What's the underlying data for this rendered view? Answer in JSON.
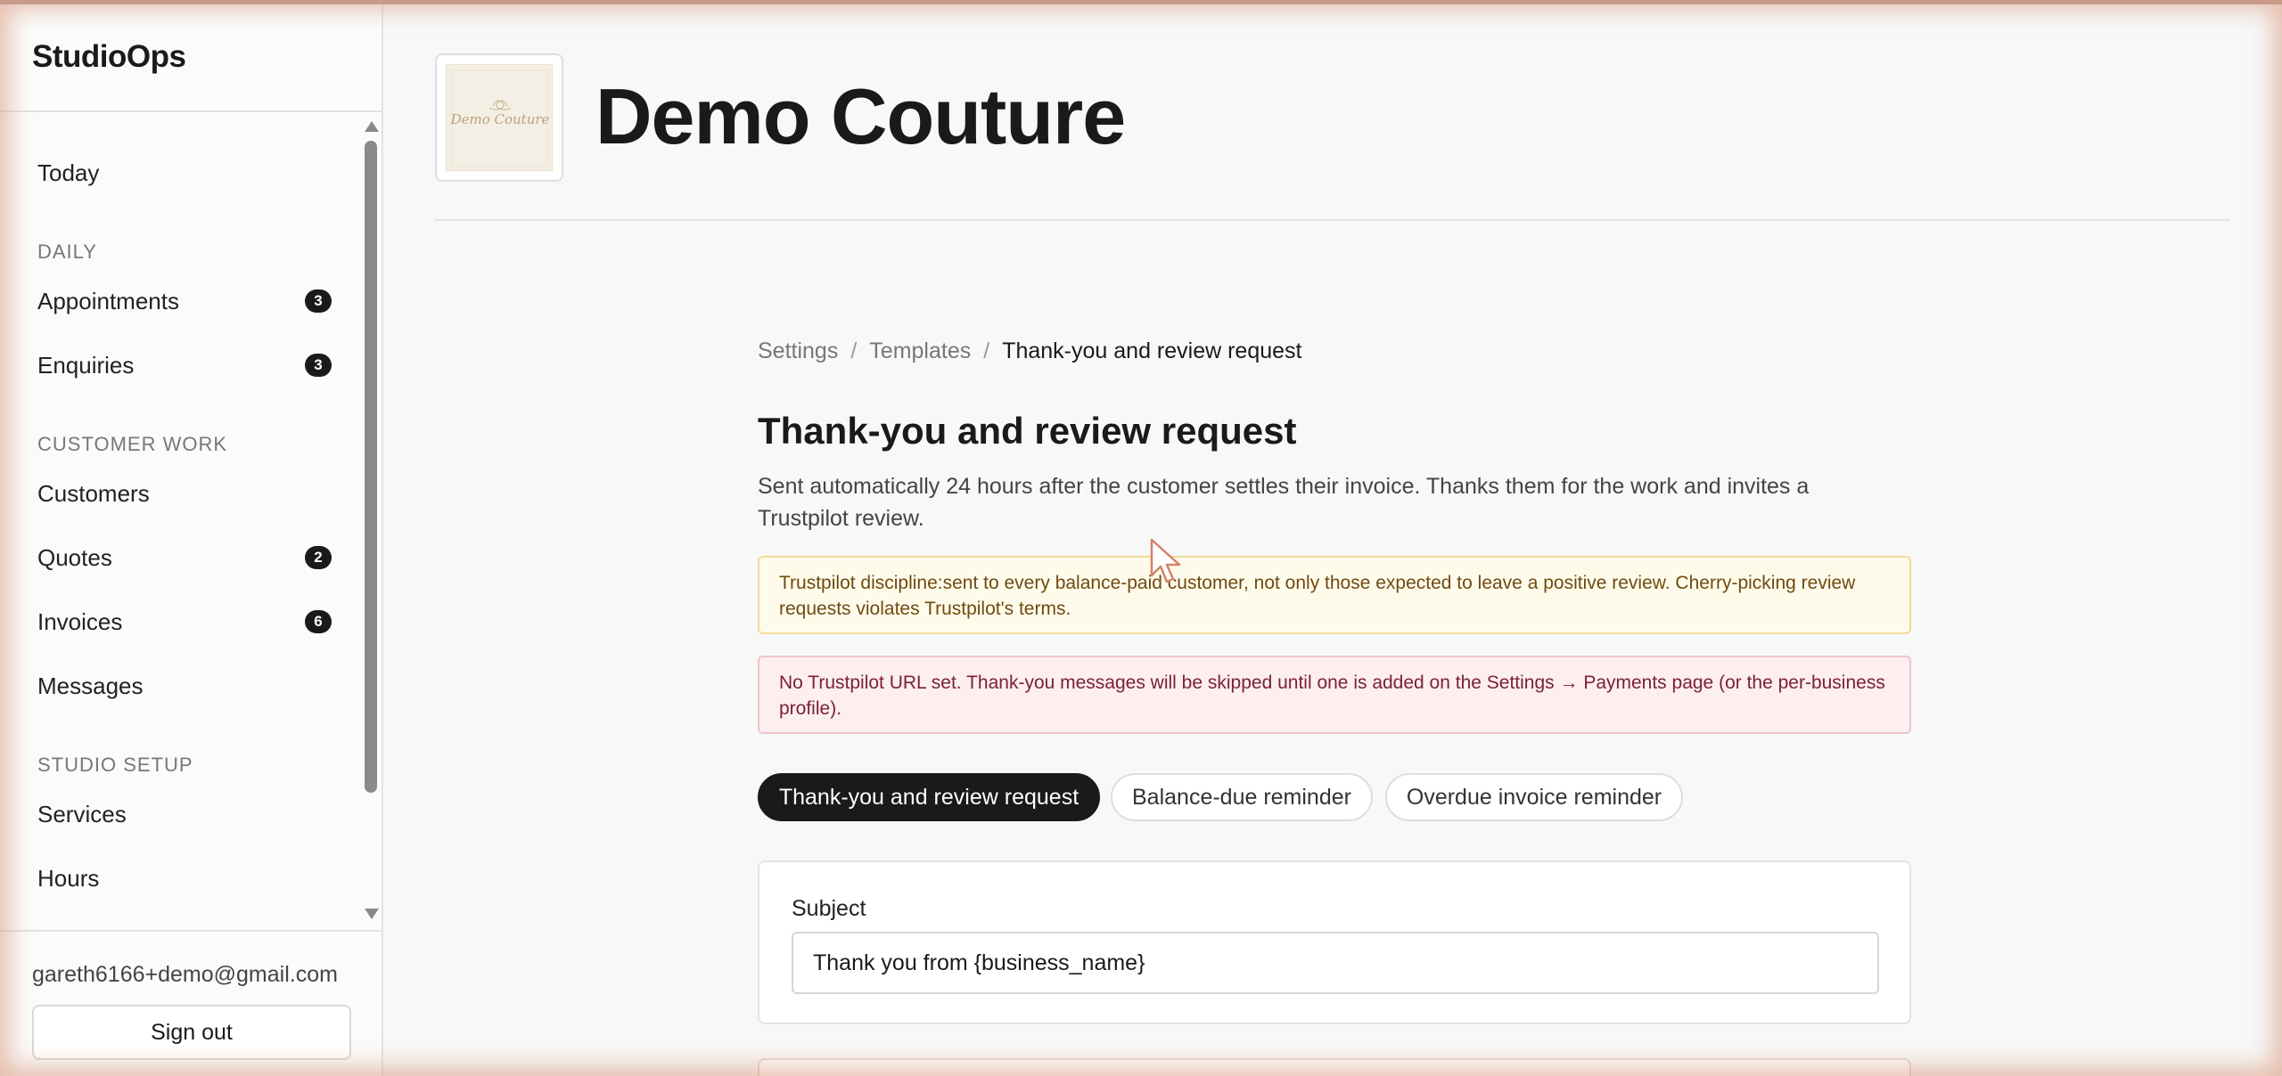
{
  "app": {
    "brand": "StudioOps"
  },
  "sidebar": {
    "items": [
      {
        "label": "Today"
      },
      {
        "section": "DAILY"
      },
      {
        "label": "Appointments",
        "badge": "3"
      },
      {
        "label": "Enquiries",
        "badge": "3"
      },
      {
        "section": "CUSTOMER WORK"
      },
      {
        "label": "Customers"
      },
      {
        "label": "Quotes",
        "badge": "2"
      },
      {
        "label": "Invoices",
        "badge": "6"
      },
      {
        "label": "Messages"
      },
      {
        "section": "STUDIO SETUP"
      },
      {
        "label": "Services"
      },
      {
        "label": "Hours"
      }
    ],
    "user_email": "gareth6166+demo@gmail.com",
    "sign_out_label": "Sign out"
  },
  "header": {
    "business_name": "Demo Couture",
    "logo_text": "Demo Couture"
  },
  "breadcrumb": {
    "items": [
      "Settings",
      "Templates"
    ],
    "current": "Thank-you and review request",
    "separator": "/"
  },
  "page": {
    "title": "Thank-you and review request",
    "description": "Sent automatically 24 hours after the customer settles their invoice. Thanks them for the work and invites a Trustpilot review."
  },
  "notices": {
    "warning": "Trustpilot discipline:sent to every balance-paid customer, not only those expected to leave a positive review. Cherry-picking review requests violates Trustpilot's terms.",
    "error": "No Trustpilot URL set. Thank-you messages will be skipped until one is added on the Settings → Payments page (or the per-business profile)."
  },
  "tabs": [
    {
      "label": "Thank-you and review request",
      "active": true
    },
    {
      "label": "Balance-due reminder",
      "active": false
    },
    {
      "label": "Overdue invoice reminder",
      "active": false
    }
  ],
  "form": {
    "subject_label": "Subject",
    "subject_value": "Thank you from {business_name}"
  },
  "colors": {
    "accent": "#1a1a1a",
    "warning_bg": "#fffbea",
    "error_bg": "#fdeef0",
    "frame_glow": "#d68c6e"
  },
  "icons": {
    "cursor": "mouse-pointer-icon",
    "scroll_up": "scroll-up-arrow-icon",
    "scroll_down": "scroll-down-arrow-icon"
  }
}
